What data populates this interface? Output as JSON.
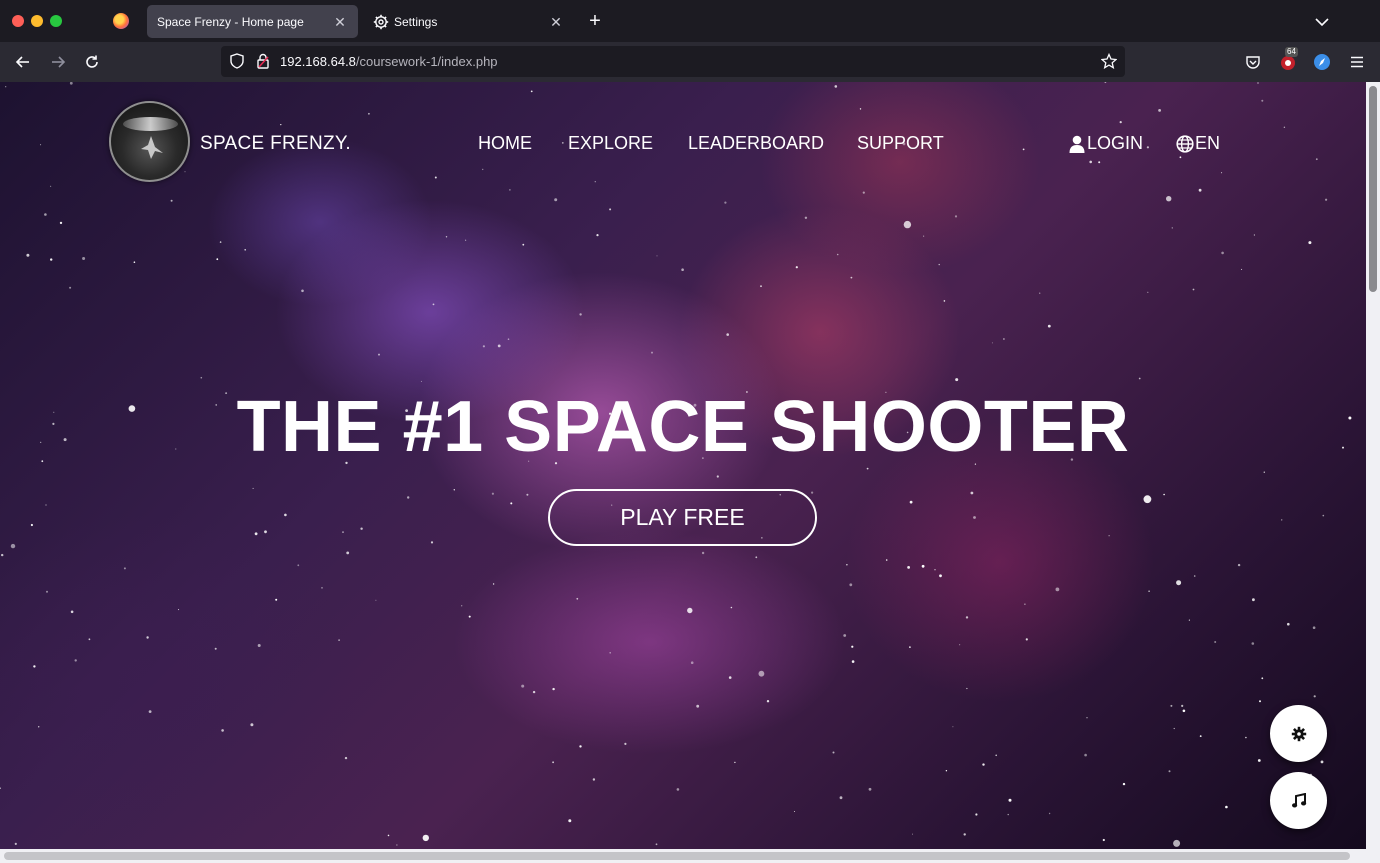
{
  "browser": {
    "tabs": [
      {
        "title": "Space Frenzy - Home page",
        "active": true
      },
      {
        "title": "Settings",
        "active": false
      }
    ],
    "url": {
      "host": "192.168.64.8",
      "path": "/coursework-1/index.php"
    },
    "extension_badge": "64",
    "icons": [
      "back-icon",
      "forward-icon",
      "reload-icon",
      "shield-icon",
      "lock-icon",
      "star-icon",
      "pocket-icon",
      "extension-icon",
      "menu-icon"
    ]
  },
  "site": {
    "brand": "SPACE FRENZY.",
    "nav": [
      {
        "label": "HOME"
      },
      {
        "label": "EXPLORE"
      },
      {
        "label": "LEADERBOARD"
      },
      {
        "label": "SUPPORT"
      }
    ],
    "login_label": "LOGIN",
    "language_label": "EN"
  },
  "hero": {
    "title": "THE #1 SPACE SHOOTER",
    "cta_label": "PLAY FREE"
  },
  "floating_buttons": [
    {
      "icon": "gear-icon"
    },
    {
      "icon": "music-note-icon"
    }
  ],
  "colors": {
    "browser_tabbar": "#1c1b22",
    "browser_navbar": "#2b2a33",
    "active_tab": "#42414d",
    "nebula_pink": "#c45ccc",
    "nebula_purple": "#7b55c9",
    "text": "#ffffff"
  }
}
